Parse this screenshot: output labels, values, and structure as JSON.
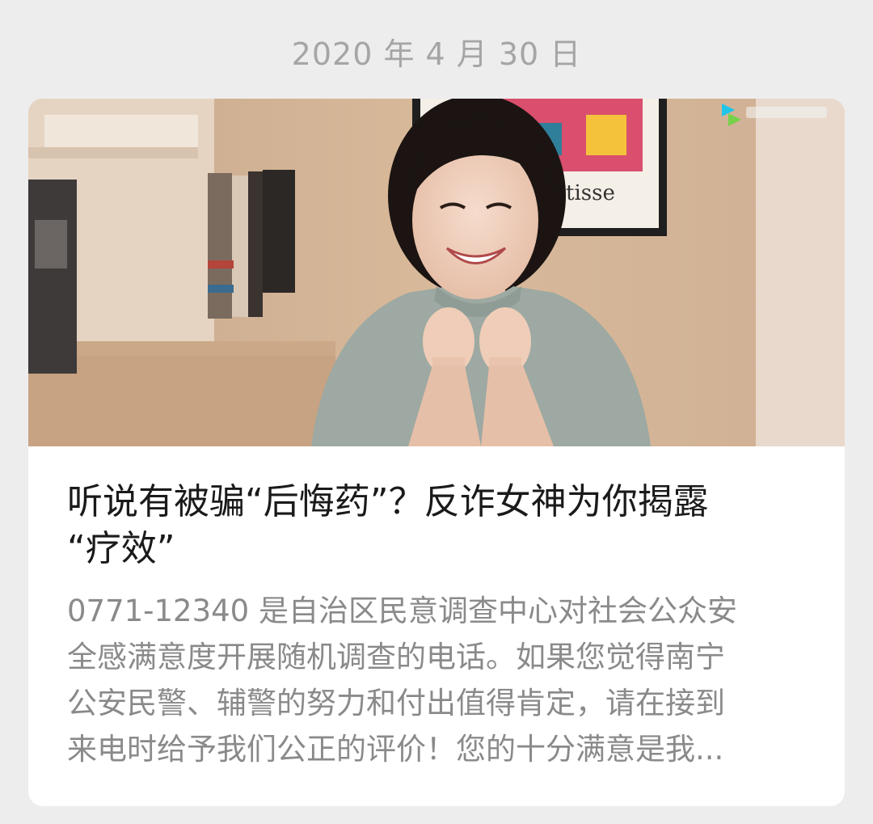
{
  "date_header": "2020 年 4 月 30 日",
  "article": {
    "title_line1": "听说有被骗“后悔药”？反诈女神为你揭露",
    "title_line2": "“疗效”",
    "summary_lines": [
      "0771-12340 是自治区民意调查中心对社会公众安",
      "全感满意度开展随机调查的电话。如果您觉得南宁",
      "公安民警、辅警的努力和付出值得肯定，请在接到",
      "来电时给予我们公正的评价！您的十分满意是我..."
    ],
    "cover_poster_text": "tisse",
    "cover_icon": "video-platform-logo-icon"
  }
}
